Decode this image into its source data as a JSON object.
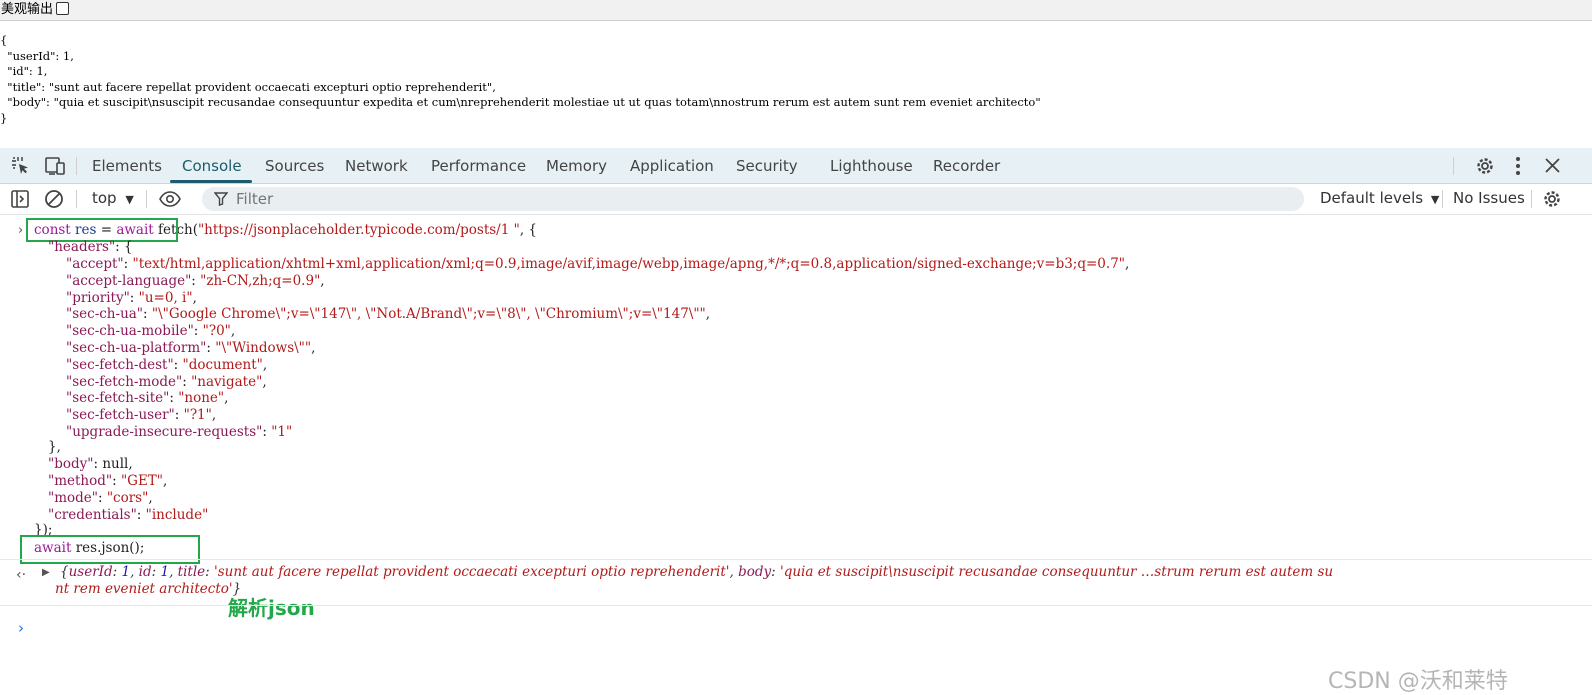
{
  "topbar": {
    "pretty_print_label": "美观输出"
  },
  "raw_json": "{\n  \"userId\": 1,\n  \"id\": 1,\n  \"title\": \"sunt aut facere repellat provident occaecati excepturi optio reprehenderit\",\n  \"body\": \"quia et suscipit\\nsuscipit recusandae consequuntur expedita et cum\\nreprehenderit molestiae ut ut quas totam\\nnostrum rerum est autem sunt rem eveniet architecto\"\n}",
  "devtools": {
    "tabs": [
      "Elements",
      "Console",
      "Sources",
      "Network",
      "Performance",
      "Memory",
      "Application",
      "Security",
      "Lighthouse",
      "Recorder"
    ],
    "active_tab": "Console",
    "toolbar": {
      "context": "top",
      "filter_placeholder": "Filter",
      "levels": "Default levels",
      "issues": "No Issues"
    }
  },
  "console": {
    "code": {
      "line1": {
        "kw1": "const",
        "var": "res",
        "eq": " = ",
        "kw2": "await",
        "rest_fn": "fetch(",
        "url": "\"https://jsonplaceholder.typicode.com/posts/1 \"",
        "tail": ", {"
      },
      "headers_key": "\"headers\"",
      "header_entries": [
        {
          "k": "\"accept\"",
          "v": "\"text/html,application/xhtml+xml,application/xml;q=0.9,image/avif,image/webp,image/apng,*/*;q=0.8,application/signed-exchange;v=b3;q=0.7\""
        },
        {
          "k": "\"accept-language\"",
          "v": "\"zh-CN,zh;q=0.9\""
        },
        {
          "k": "\"priority\"",
          "v": "\"u=0, i\""
        },
        {
          "k": "\"sec-ch-ua\"",
          "v": "\"\\\"Google Chrome\\\";v=\\\"147\\\", \\\"Not.A/Brand\\\";v=\\\"8\\\", \\\"Chromium\\\";v=\\\"147\\\"\""
        },
        {
          "k": "\"sec-ch-ua-mobile\"",
          "v": "\"?0\""
        },
        {
          "k": "\"sec-ch-ua-platform\"",
          "v": "\"\\\"Windows\\\"\""
        },
        {
          "k": "\"sec-fetch-dest\"",
          "v": "\"document\""
        },
        {
          "k": "\"sec-fetch-mode\"",
          "v": "\"navigate\""
        },
        {
          "k": "\"sec-fetch-site\"",
          "v": "\"none\""
        },
        {
          "k": "\"sec-fetch-user\"",
          "v": "\"?1\""
        },
        {
          "k": "\"upgrade-insecure-requests\"",
          "v": "\"1\""
        }
      ],
      "body_key": "\"body\"",
      "body_val": "null",
      "method_key": "\"method\"",
      "method_val": "\"GET\"",
      "mode_key": "\"mode\"",
      "mode_val": "\"cors\"",
      "cred_key": "\"credentials\"",
      "cred_val": "\"include\"",
      "close": "});",
      "line2_kw": "await",
      "line2_rest": " res.json();"
    },
    "result": {
      "k1": "userId",
      "v1": "1",
      "k2": "id",
      "v2": "1",
      "k3": "title",
      "v3": "'sunt aut facere repellat provident occaecati excepturi optio reprehenderit'",
      "k4": "body",
      "v4a": "'quia et suscipit\\nsuscipit recusandae consequuntur …strum rerum est autem su",
      "v4b": "nt rem eveniet architecto'"
    },
    "annotation": "解析json",
    "watermark": "CSDN @沃和莱特"
  },
  "colors": {
    "highlight_box": "#22a84a",
    "active_tab": "#1a5c6e",
    "tabbar_bg": "#e7f1f5"
  }
}
